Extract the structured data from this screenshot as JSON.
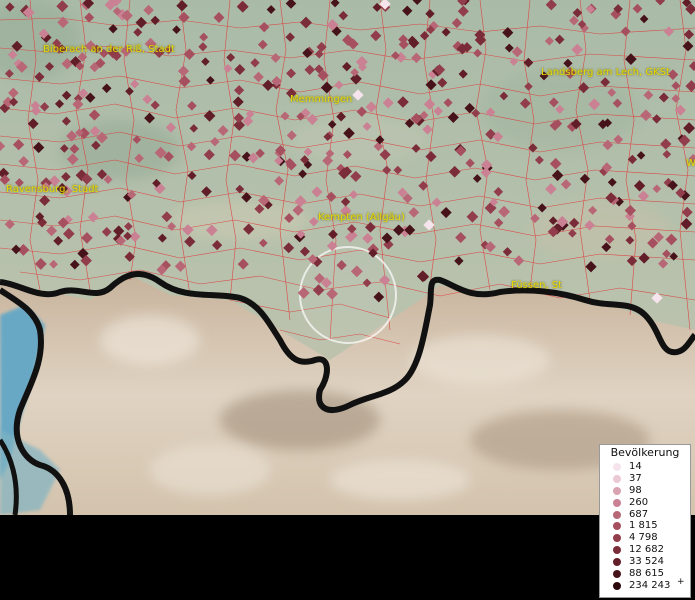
{
  "cities": [
    {
      "name": "Biberach an der Riß, Stadt"
    },
    {
      "name": "Memmingen"
    },
    {
      "name": "Landsberg am Lech, GKSt"
    },
    {
      "name": "Ravensburg, Stadt"
    },
    {
      "name": "Kempten (Allgäu)"
    },
    {
      "name": "Füssen, St"
    },
    {
      "name": "W"
    }
  ],
  "legend": {
    "title": "Bevölkerung",
    "items": [
      {
        "label": "14",
        "color": "#f6e4ec"
      },
      {
        "label": "37",
        "color": "#ebc9d3"
      },
      {
        "label": "98",
        "color": "#d9a3b2"
      },
      {
        "label": "260",
        "color": "#c98193"
      },
      {
        "label": "687",
        "color": "#b86777"
      },
      {
        "label": "1 815",
        "color": "#a6505f"
      },
      {
        "label": "4 798",
        "color": "#923d4b"
      },
      {
        "label": "12 682",
        "color": "#7b2c39"
      },
      {
        "label": "33 524",
        "color": "#611d28"
      },
      {
        "label": "88 615",
        "color": "#47131b"
      },
      {
        "label": "234 243",
        "color": "#2b080c",
        "plus": "+"
      }
    ]
  }
}
